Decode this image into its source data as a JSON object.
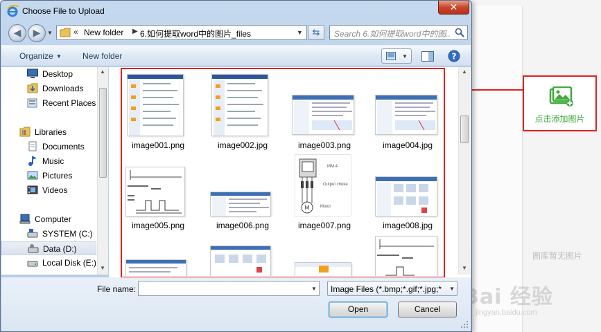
{
  "dialog": {
    "title": "Choose File to Upload",
    "close_label": "✕"
  },
  "address": {
    "chevrons": "«",
    "segments": [
      "New folder",
      "6.如何提取word中的图片_files"
    ],
    "separator": "▶"
  },
  "search": {
    "placeholder": "Search 6.如何提取word中的图..."
  },
  "toolbar": {
    "organize_label": "Organize",
    "new_folder_label": "New folder"
  },
  "nav": {
    "favorites": [
      {
        "label": "Desktop",
        "icon": "desktop-icon"
      },
      {
        "label": "Downloads",
        "icon": "downloads-folder-icon"
      },
      {
        "label": "Recent Places",
        "icon": "recent-places-icon"
      }
    ],
    "libraries_label": "Libraries",
    "libraries": [
      {
        "label": "Documents",
        "icon": "documents-icon"
      },
      {
        "label": "Music",
        "icon": "music-icon"
      },
      {
        "label": "Pictures",
        "icon": "pictures-icon"
      },
      {
        "label": "Videos",
        "icon": "videos-icon"
      }
    ],
    "computer_label": "Computer",
    "drives": [
      {
        "label": "SYSTEM (C:)",
        "icon": "drive-icon"
      },
      {
        "label": "Data (D:)",
        "icon": "drive-icon",
        "selected": true
      },
      {
        "label": "Local Disk (E:)",
        "icon": "drive-icon"
      }
    ]
  },
  "files": [
    {
      "name": "image001.png"
    },
    {
      "name": "image002.jpg"
    },
    {
      "name": "image003.png"
    },
    {
      "name": "image004.jpg"
    },
    {
      "name": "image005.png"
    },
    {
      "name": "image006.png"
    },
    {
      "name": "image007.png"
    },
    {
      "name": "image008.jpg"
    },
    {
      "name": ""
    },
    {
      "name": ""
    },
    {
      "name": ""
    },
    {
      "name": ""
    }
  ],
  "thumbnail_text": {
    "motor": "Motor",
    "output_choke": "Output choke",
    "mm4": "MM 4"
  },
  "filename": {
    "label": "File name:",
    "value": ""
  },
  "filetype": {
    "selected": "Image Files (*.bmp;*.gif;*.jpg;*.j"
  },
  "buttons": {
    "open_label": "Open",
    "cancel_label": "Cancel"
  },
  "page": {
    "add_image_label": "点击添加图片",
    "empty_text": "图库暂无图片",
    "watermark": "Bai 经验",
    "watermark_sub": "jingyan.baidu.com"
  },
  "colors": {
    "highlight": "#e0201e",
    "add_image_green": "#3fa93a",
    "dialog_frame": "#b9cfe8"
  }
}
